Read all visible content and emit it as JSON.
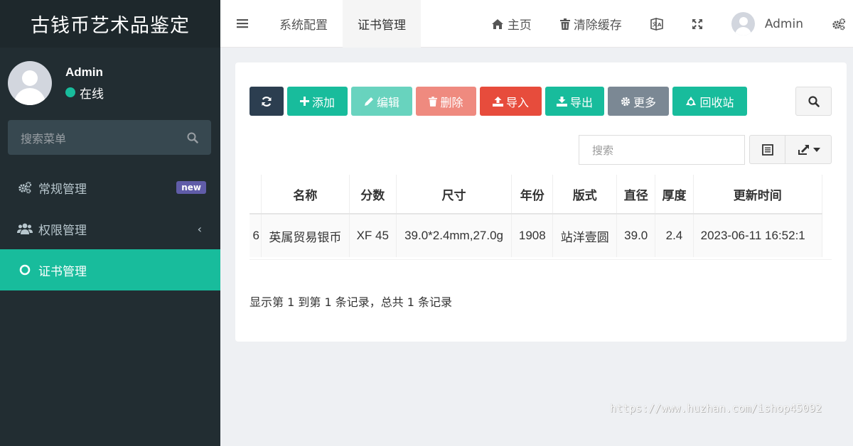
{
  "app": {
    "title": "古钱币艺术品鉴定"
  },
  "user": {
    "name": "Admin",
    "status": "在线"
  },
  "sidebar": {
    "search_placeholder": "搜索菜单",
    "items": [
      {
        "label": "常规管理",
        "icon": "gears-icon",
        "badge": "new"
      },
      {
        "label": "权限管理",
        "icon": "users-icon"
      },
      {
        "label": "证书管理",
        "icon": "circle-icon",
        "active": true
      }
    ]
  },
  "navbar": {
    "tabs": [
      {
        "label": "系统配置"
      },
      {
        "label": "证书管理",
        "active": true
      }
    ],
    "home_label": "主页",
    "clear_cache_label": "清除缓存",
    "user_name": "Admin"
  },
  "toolbar": {
    "add": "添加",
    "edit": "编辑",
    "delete": "删除",
    "import": "导入",
    "export": "导出",
    "more": "更多",
    "recycle": "回收站"
  },
  "table": {
    "search_placeholder": "搜索",
    "headers": [
      "名称",
      "分数",
      "尺寸",
      "年份",
      "版式",
      "直径",
      "厚度",
      "更新时间"
    ],
    "rows": [
      {
        "id_partial": "6",
        "cells": [
          "英属贸易银币",
          "XF 45",
          "39.0*2.4mm,27.0g",
          "1908",
          "站洋壹圆",
          "39.0",
          "2.4",
          "2023-06-11 16:52:1"
        ]
      }
    ]
  },
  "pagination": {
    "info": "显示第 1 到第 1 条记录，总共 1 条记录"
  },
  "watermark": "https://www.huzhan.com/ishop45092",
  "colors": {
    "sidebar_bg": "#222d32",
    "accent": "#18bc9c",
    "danger": "#e74c3c",
    "dark": "#2c3e50",
    "badge": "#605ca8"
  }
}
